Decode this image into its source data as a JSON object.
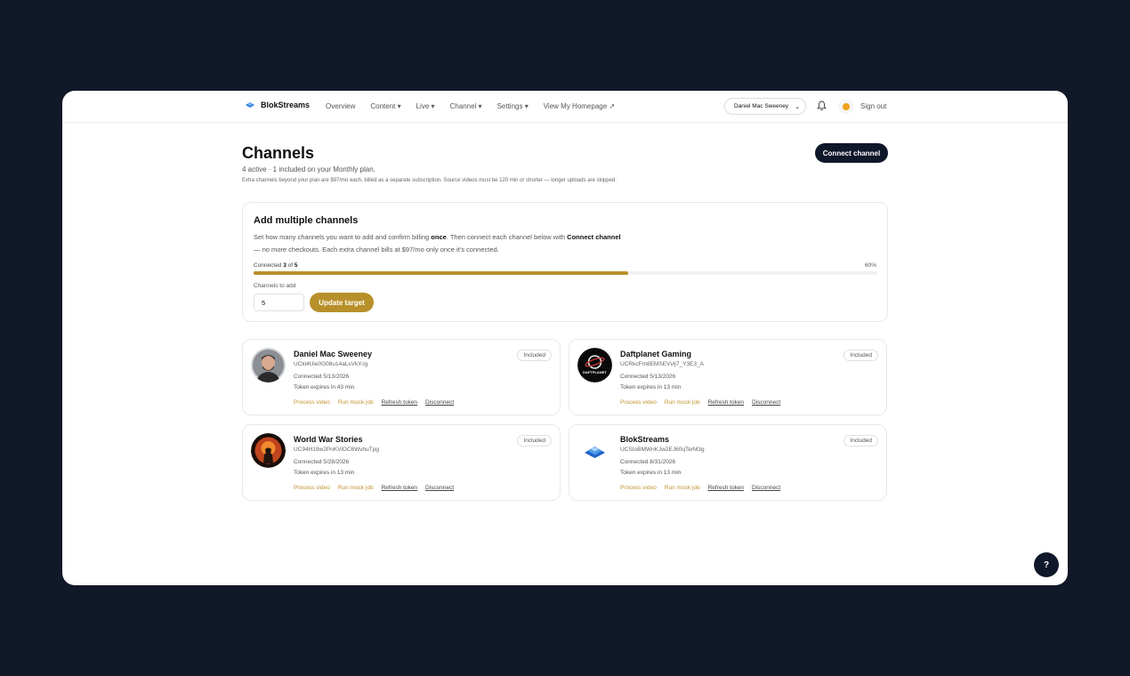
{
  "nav": {
    "brand": "BlokStreams",
    "items": [
      "Overview",
      "Content ▾",
      "Live ▾",
      "Channel ▾",
      "Settings ▾",
      "View My Homepage ↗"
    ],
    "user": "Daniel Mac Sweeney",
    "sign_out": "Sign out"
  },
  "header": {
    "title": "Channels",
    "subtitle": "4 active · 1 included on your Monthly plan.",
    "note": "Extra channels beyond your plan are $97/mo each, billed as a separate subscription. Source videos must be 120 min or shorter — longer uploads are skipped.",
    "connect_label": "Connect channel"
  },
  "multi": {
    "title": "Add multiple channels",
    "desc_a": "Set how many channels you want to add and confirm billing ",
    "desc_b": "once",
    "desc_c": ". Then connect each channel below with ",
    "desc_d": "Connect channel",
    "desc_e": " — no more checkouts. Each extra channel bills at $97/mo only once it's connected.",
    "prog_prefix": "Connected ",
    "prog_connected": "3",
    "prog_of": " of ",
    "prog_target": "5",
    "percent_label": "60%",
    "progress": 0.6,
    "add_label": "Channels to add",
    "add_value": "5",
    "update_label": "Update target"
  },
  "channels": [
    {
      "name": "Daniel Mac Sweeney",
      "id": "UCkl4Uie0G08u14aLsVkY-lg",
      "connected": "Connected 5/13/2026",
      "token": "Token expires in 43 min",
      "badge": "Included"
    },
    {
      "name": "Daftplanet Gaming",
      "id": "UCRkcFm8EMSEVvIj7_Y3E3_A",
      "connected": "Connected 5/13/2026",
      "token": "Token expires in 13 min",
      "badge": "Included",
      "logo_text": "DAFTPLANET"
    },
    {
      "name": "World War Stories",
      "id": "UC94H19w2PnKViOC6WvhuTpg",
      "connected": "Connected 5/28/2026",
      "token": "Token expires in 13 min",
      "badge": "Included"
    },
    {
      "name": "BlokStreams",
      "id": "UCSIoBMWnKJw2EJ60qTerM3g",
      "connected": "Connected 8/31/2026",
      "token": "Token expires in 13 min",
      "badge": "Included"
    }
  ],
  "actions": {
    "process": "Process video",
    "mock": "Run mock job",
    "refresh": "Refresh token",
    "disconnect": "Disconnect"
  },
  "help_label": "?",
  "colors": {
    "accent": "#b8902a",
    "dark": "#0f172a",
    "backdrop": "#111827"
  }
}
